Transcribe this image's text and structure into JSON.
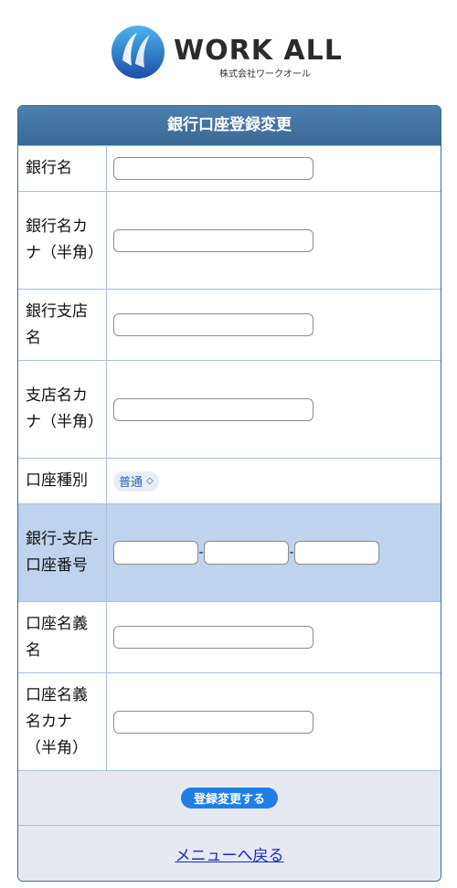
{
  "logo": {
    "word": "WORK ALL",
    "subtitle": "株式会社ワークオール"
  },
  "form": {
    "title": "銀行口座登録変更",
    "rows": [
      {
        "label": "銀行名",
        "value": ""
      },
      {
        "label": "銀行名カナ（半角）",
        "value": ""
      },
      {
        "label": "銀行支店名",
        "value": ""
      },
      {
        "label": "支店名カナ（半角）",
        "value": ""
      },
      {
        "label": "口座種別",
        "select": "普通"
      },
      {
        "label": "銀行-支店-口座番号",
        "parts": [
          "",
          "",
          ""
        ],
        "separator": "-"
      },
      {
        "label": "口座名義名",
        "value": ""
      },
      {
        "label": "口座名義名カナ（半角）",
        "value": ""
      }
    ],
    "submit_label": "登録変更する",
    "back_link": "メニューへ戻る"
  },
  "colors": {
    "header": "#3a6897",
    "row_highlight": "#bdd3ee",
    "button": "#1f7fe6",
    "link": "#1a28c8"
  }
}
